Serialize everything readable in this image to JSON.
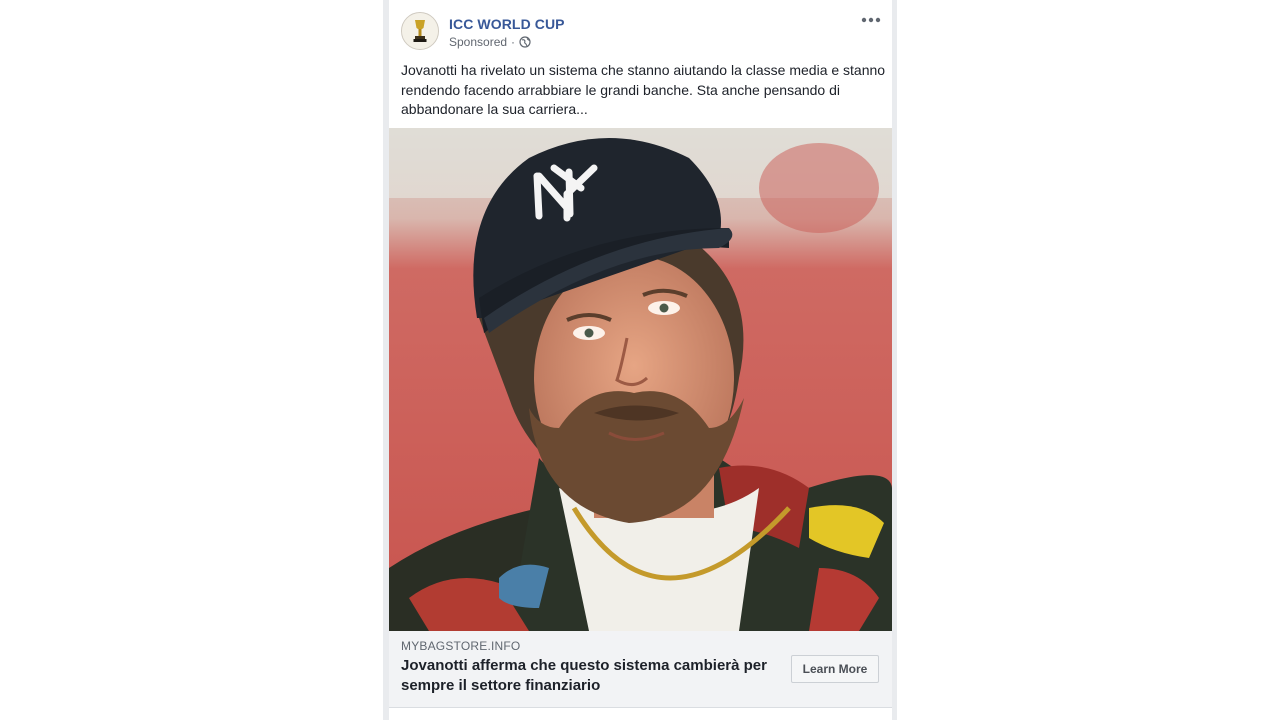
{
  "post": {
    "page_name": "ICC WORLD CUP",
    "sponsored_label": "Sponsored",
    "separator": "·",
    "privacy_icon": "globe-icon",
    "more_icon": "more-options-icon",
    "body_text": "Jovanotti ha rivelato un sistema che stanno aiutando la classe media e stanno rendendo facendo arrabbiare le grandi banche. Sta anche pensando di abbandonare la sua carriera...",
    "image_alt": "photo-of-bearded-man-in-ny-cap"
  },
  "link_preview": {
    "domain": "MYBAGSTORE.INFO",
    "title": "Jovanotti afferma che questo sistema cambierà per sempre il settore finanziario",
    "cta_label": "Learn More"
  },
  "colors": {
    "page_name": "#385898",
    "meta": "#616770",
    "body_text": "#1d2129",
    "link_bar_bg": "#f2f3f5",
    "feed_bg": "#e9ebee"
  }
}
